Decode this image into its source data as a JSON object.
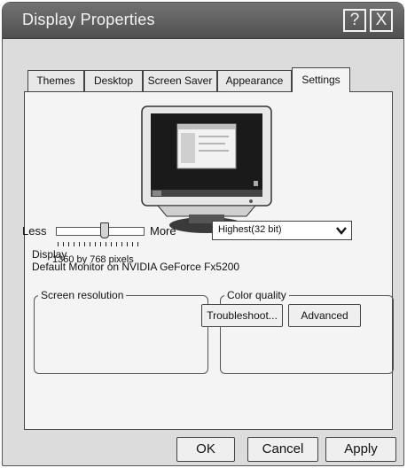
{
  "window": {
    "title": "Display Properties",
    "help_glyph": "?",
    "close_glyph": "X"
  },
  "tabs": [
    {
      "label": "Themes"
    },
    {
      "label": "Desktop"
    },
    {
      "label": "Screen Saver"
    },
    {
      "label": "Appearance"
    },
    {
      "label": "Settings",
      "active": true
    }
  ],
  "display": {
    "label": "Display",
    "value": "Default Monitor on NVIDIA  GeForce Fx5200"
  },
  "resolution": {
    "legend": "Screen resolution",
    "less_label": "Less",
    "more_label": "More",
    "slider_level": 0.55,
    "value_text": "1360 by 768 pixels"
  },
  "color_quality": {
    "legend": "Color quality",
    "selected": "Highest(32 bit)"
  },
  "buttons": {
    "troubleshoot": "Troubleshoot...",
    "advanced": "Advanced",
    "ok": "OK",
    "cancel": "Cancel",
    "apply": "Apply"
  },
  "colors": {
    "titlebar": "#5e5e5e",
    "window_bg": "#dcdcdc",
    "panel_bg": "#f4f4f4"
  },
  "icons": {
    "help": "help-icon",
    "close": "close-icon",
    "dropdown": "chevron-down-icon",
    "monitor": "monitor-icon"
  }
}
